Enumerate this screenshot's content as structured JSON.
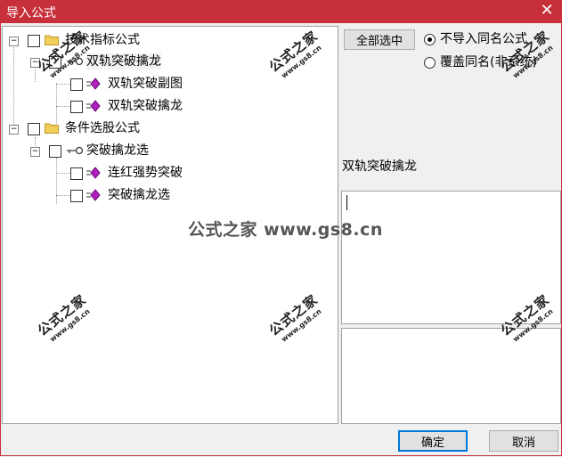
{
  "window": {
    "title": "导入公式",
    "close_glyph": "✕"
  },
  "tree": {
    "expander_minus": "−",
    "groups": [
      {
        "label": "技术指标公式",
        "children": [
          {
            "label": "双轨突破擒龙",
            "children": [
              {
                "label": "双轨突破副图"
              },
              {
                "label": "双轨突破擒龙"
              }
            ]
          }
        ]
      },
      {
        "label": "条件选股公式",
        "children": [
          {
            "label": "突破擒龙选",
            "children": [
              {
                "label": "连红强势突破"
              },
              {
                "label": "突破擒龙选"
              }
            ]
          }
        ]
      }
    ]
  },
  "options": {
    "select_all_label": "全部选中",
    "radio_skip_label": "不导入同名公式",
    "radio_overwrite_label": "覆盖同名(非系统)",
    "selected": "skip"
  },
  "detail": {
    "formula_name": "双轨突破擒龙",
    "description_value": "",
    "notes_value": ""
  },
  "footer": {
    "ok_label": "确定",
    "cancel_label": "取消"
  },
  "watermarks": {
    "stamp_text": "公式之家",
    "stamp_url": "www.gs8.cn",
    "center_text": "公式之家 www.gs8.cn"
  },
  "colors": {
    "titlebar": "#c7303a",
    "purple_icon": "#b020c0",
    "folder": "#f3d05a"
  }
}
